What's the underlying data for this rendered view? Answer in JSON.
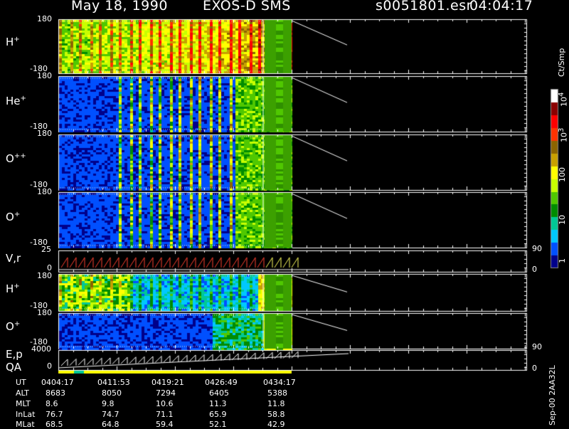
{
  "header": {
    "date": "May 18, 1990",
    "mission": "EXOS-D SMS",
    "file": "s0051801.esr",
    "time": "04:04:17"
  },
  "panels": [
    {
      "label_base": "H",
      "label_sup": "+",
      "ymax": "180",
      "ymin": "-180"
    },
    {
      "label_base": "He",
      "label_sup": "+",
      "ymax": "180",
      "ymin": "-180"
    },
    {
      "label_base": "O",
      "label_sup": "++",
      "ymax": "180",
      "ymin": "-180"
    },
    {
      "label_base": "O",
      "label_sup": "+",
      "ymax": "180",
      "ymin": "-180"
    },
    {
      "label_base": "V,r",
      "label_sup": "",
      "ymax": "25",
      "ymin": "0",
      "right_top": "90",
      "right_bottom": "0"
    },
    {
      "label_base": "H",
      "label_sup": "+",
      "ymax": "180",
      "ymin": "-180"
    },
    {
      "label_base": "O",
      "label_sup": "+",
      "ymax": "180",
      "ymin": "-180"
    },
    {
      "label_base": "E,p",
      "label_sup": "",
      "ymax": "4000",
      "ymin": "0",
      "right_top": "90",
      "right_bottom": "0"
    }
  ],
  "qa_label": "QA",
  "colorbar": {
    "unit": "Ct/Smp",
    "ticks": [
      {
        "base": "10",
        "sup": "4"
      },
      {
        "base": "10",
        "sup": "3"
      },
      {
        "base": "100",
        "sup": ""
      },
      {
        "base": "10",
        "sup": ""
      },
      {
        "base": "1",
        "sup": ""
      }
    ]
  },
  "ephemeris": {
    "rows": [
      {
        "name": "UT",
        "values": [
          "0404:17",
          "0411:53",
          "0419:21",
          "0426:49",
          "0434:17"
        ]
      },
      {
        "name": "ALT",
        "values": [
          "8683",
          "8050",
          "7294",
          "6405",
          "5388"
        ]
      },
      {
        "name": "MLT",
        "values": [
          "8.6",
          "9.8",
          "10.6",
          "11.3",
          "11.8"
        ]
      },
      {
        "name": "InLat",
        "values": [
          "76.7",
          "74.7",
          "71.1",
          "65.9",
          "58.8"
        ]
      },
      {
        "name": "MLat",
        "values": [
          "68.5",
          "64.8",
          "59.4",
          "52.1",
          "42.9"
        ]
      }
    ]
  },
  "footer_stamp": "Sep-00  2AA32L",
  "chart_data": {
    "type": "heatmap",
    "panels": [
      "H+",
      "He+",
      "O++",
      "O+",
      "V,r",
      "H+",
      "O+",
      "E,p"
    ],
    "x_ticks": [
      "0404:17",
      "0411:53",
      "0419:21",
      "0426:49",
      "0434:17"
    ],
    "colorscale": [
      "#00008b",
      "#0050ff",
      "#00c8ff",
      "#00c896",
      "#008c00",
      "#50c800",
      "#c8ff00",
      "#ffff00",
      "#c8a000",
      "#8c6400",
      "#ff3200",
      "#ff0000",
      "#8b0000",
      "#ffffff"
    ],
    "colorbar_range": [
      1,
      10000
    ],
    "vr_range": [
      0,
      25
    ],
    "ep_range": [
      0,
      4000
    ],
    "angle_range": [
      -180,
      180
    ]
  }
}
